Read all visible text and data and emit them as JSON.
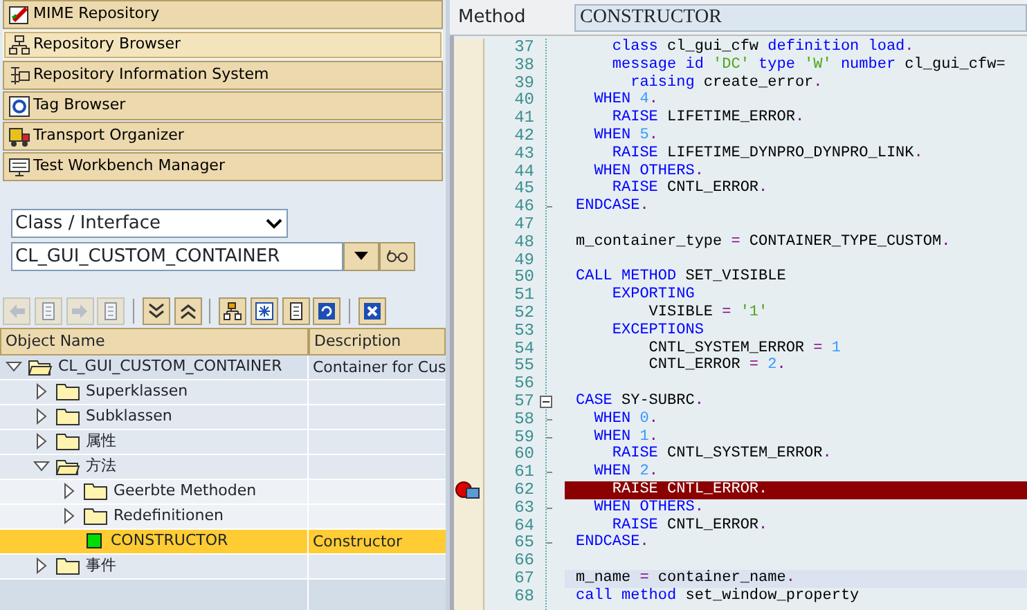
{
  "nav_buttons": [
    {
      "label": "MIME Repository",
      "selected": false
    },
    {
      "label": "Repository Browser",
      "selected": true
    },
    {
      "label": "Repository Information System",
      "selected": false
    },
    {
      "label": "Tag Browser",
      "selected": false
    },
    {
      "label": "Transport Organizer",
      "selected": false
    },
    {
      "label": "Test Workbench Manager",
      "selected": false
    }
  ],
  "object_type": {
    "value": "Class / Interface"
  },
  "object_name": {
    "value": "CL_GUI_CUSTOM_CONTAINER"
  },
  "toolbar": [
    {
      "kind": "back",
      "disabled": true
    },
    {
      "kind": "doc",
      "disabled": true
    },
    {
      "kind": "forward",
      "disabled": true
    },
    {
      "kind": "doc",
      "disabled": true
    },
    {
      "kind": "sep"
    },
    {
      "kind": "expand",
      "disabled": false
    },
    {
      "kind": "collapse",
      "disabled": false
    },
    {
      "kind": "sep"
    },
    {
      "kind": "hierarchy",
      "disabled": false
    },
    {
      "kind": "new",
      "disabled": false
    },
    {
      "kind": "doc",
      "disabled": false
    },
    {
      "kind": "refresh",
      "disabled": false
    },
    {
      "kind": "sep"
    },
    {
      "kind": "close",
      "disabled": false
    }
  ],
  "tree": {
    "columns": [
      "Object Name",
      "Description"
    ],
    "rows": [
      {
        "name": "CL_GUI_CUSTOM_CONTAINER",
        "description": "Container for Cus",
        "expanded": true,
        "selected": false,
        "children": [
          {
            "name": "Superklassen",
            "expanded": false,
            "selected": false
          },
          {
            "name": "Subklassen",
            "expanded": false,
            "selected": false
          },
          {
            "name": "属性",
            "expanded": false,
            "selected": false
          },
          {
            "name": "方法",
            "expanded": true,
            "selected": false,
            "children": [
              {
                "name": "Geerbte Methoden",
                "expanded": false,
                "selected": false
              },
              {
                "name": "Redefinitionen",
                "expanded": false,
                "selected": false
              },
              {
                "name": "CONSTRUCTOR",
                "description": "Constructor",
                "selected": true
              }
            ]
          },
          {
            "name": "事件",
            "expanded": false,
            "selected": false
          }
        ]
      }
    ]
  },
  "editor": {
    "label": "Method",
    "value": "CONSTRUCTOR",
    "lines": [
      {
        "number": "37",
        "tokens": [
          {
            "kind": "kw",
            "text": "    class"
          },
          {
            "kind": "txt",
            "text": " cl_gui_cfw "
          },
          {
            "kind": "kw",
            "text": "definition load"
          },
          {
            "kind": "op",
            "text": "."
          }
        ]
      },
      {
        "number": "38",
        "tokens": [
          {
            "kind": "kw",
            "text": "    message id "
          },
          {
            "kind": "str",
            "text": "'DC'"
          },
          {
            "kind": "kw",
            "text": " type "
          },
          {
            "kind": "str",
            "text": "'W'"
          },
          {
            "kind": "kw",
            "text": " number"
          },
          {
            "kind": "txt",
            "text": " cl_gui_cfw="
          }
        ]
      },
      {
        "number": "39",
        "tokens": [
          {
            "kind": "kw",
            "text": "      raising"
          },
          {
            "kind": "txt",
            "text": " create_error"
          },
          {
            "kind": "op",
            "text": "."
          }
        ]
      },
      {
        "number": "40",
        "tokens": [
          {
            "kind": "kw",
            "text": "  WHEN"
          },
          {
            "kind": "num",
            "text": " 4"
          },
          {
            "kind": "op",
            "text": "."
          }
        ]
      },
      {
        "number": "41",
        "tokens": [
          {
            "kind": "kw",
            "text": "    RAISE"
          },
          {
            "kind": "txt",
            "text": " LIFETIME_ERROR"
          },
          {
            "kind": "op",
            "text": "."
          }
        ]
      },
      {
        "number": "42",
        "tokens": [
          {
            "kind": "kw",
            "text": "  WHEN"
          },
          {
            "kind": "num",
            "text": " 5"
          },
          {
            "kind": "op",
            "text": "."
          }
        ]
      },
      {
        "number": "43",
        "tokens": [
          {
            "kind": "kw",
            "text": "    RAISE"
          },
          {
            "kind": "txt",
            "text": " LIFETIME_DYNPRO_DYNPRO_LINK"
          },
          {
            "kind": "op",
            "text": "."
          }
        ]
      },
      {
        "number": "44",
        "tokens": [
          {
            "kind": "kw",
            "text": "  WHEN OTHERS"
          },
          {
            "kind": "op",
            "text": "."
          }
        ]
      },
      {
        "number": "45",
        "tokens": [
          {
            "kind": "kw",
            "text": "    RAISE"
          },
          {
            "kind": "txt",
            "text": " CNTL_ERROR"
          },
          {
            "kind": "op",
            "text": "."
          }
        ]
      },
      {
        "number": "46",
        "kind": "fold_end",
        "tokens": [
          {
            "kind": "kw",
            "text": "ENDCASE"
          },
          {
            "kind": "op",
            "text": "."
          }
        ]
      },
      {
        "number": "47"
      },
      {
        "number": "48",
        "tokens": [
          {
            "kind": "txt",
            "text": "m_container_type "
          },
          {
            "kind": "op",
            "text": "="
          },
          {
            "kind": "txt",
            "text": " CONTAINER_TYPE_CUSTOM"
          },
          {
            "kind": "op",
            "text": "."
          }
        ]
      },
      {
        "number": "49"
      },
      {
        "number": "50",
        "tokens": [
          {
            "kind": "kw",
            "text": "CALL METHOD"
          },
          {
            "kind": "txt",
            "text": " SET_VISIBLE"
          }
        ]
      },
      {
        "number": "51",
        "tokens": [
          {
            "kind": "kw",
            "text": "    EXPORTING"
          }
        ]
      },
      {
        "number": "52",
        "tokens": [
          {
            "kind": "txt",
            "text": "        VISIBLE "
          },
          {
            "kind": "op",
            "text": "="
          },
          {
            "kind": "str",
            "text": " '1'"
          }
        ]
      },
      {
        "number": "53",
        "tokens": [
          {
            "kind": "kw",
            "text": "    EXCEPTIONS"
          }
        ]
      },
      {
        "number": "54",
        "tokens": [
          {
            "kind": "txt",
            "text": "        CNTL_SYSTEM_ERROR "
          },
          {
            "kind": "op",
            "text": "="
          },
          {
            "kind": "num",
            "text": " 1"
          }
        ]
      },
      {
        "number": "55",
        "tokens": [
          {
            "kind": "txt",
            "text": "        CNTL_ERROR "
          },
          {
            "kind": "op",
            "text": "="
          },
          {
            "kind": "num",
            "text": " 2"
          },
          {
            "kind": "op",
            "text": "."
          }
        ]
      },
      {
        "number": "56"
      },
      {
        "number": "57",
        "kind": "fold_start",
        "tokens": [
          {
            "kind": "kw",
            "text": "CASE"
          },
          {
            "kind": "txt",
            "text": " SY-SUBRC"
          },
          {
            "kind": "op",
            "text": "."
          }
        ]
      },
      {
        "number": "58",
        "kind": "fold_branch",
        "tokens": [
          {
            "kind": "kw",
            "text": "  WHEN"
          },
          {
            "kind": "num",
            "text": " 0"
          },
          {
            "kind": "op",
            "text": "."
          }
        ]
      },
      {
        "number": "59",
        "kind": "fold_branch",
        "tokens": [
          {
            "kind": "kw",
            "text": "  WHEN"
          },
          {
            "kind": "num",
            "text": " 1"
          },
          {
            "kind": "op",
            "text": "."
          }
        ]
      },
      {
        "number": "60",
        "tokens": [
          {
            "kind": "kw",
            "text": "    RAISE"
          },
          {
            "kind": "txt",
            "text": " CNTL_SYSTEM_ERROR"
          },
          {
            "kind": "op",
            "text": "."
          }
        ]
      },
      {
        "number": "61",
        "kind": "fold_branch",
        "tokens": [
          {
            "kind": "kw",
            "text": "  WHEN"
          },
          {
            "kind": "num",
            "text": " 2"
          },
          {
            "kind": "op",
            "text": "."
          }
        ]
      },
      {
        "number": "62",
        "breakpoint": true,
        "tokens": [
          {
            "kind": "kw",
            "text": "    RAISE"
          },
          {
            "kind": "txt",
            "text": " CNTL_ERROR"
          },
          {
            "kind": "op",
            "text": "."
          }
        ]
      },
      {
        "number": "63",
        "kind": "fold_branch",
        "tokens": [
          {
            "kind": "kw",
            "text": "  WHEN OTHERS"
          },
          {
            "kind": "op",
            "text": "."
          }
        ]
      },
      {
        "number": "64",
        "tokens": [
          {
            "kind": "kw",
            "text": "    RAISE"
          },
          {
            "kind": "txt",
            "text": " CNTL_ERROR"
          },
          {
            "kind": "op",
            "text": "."
          }
        ]
      },
      {
        "number": "65",
        "kind": "fold_end",
        "tokens": [
          {
            "kind": "kw",
            "text": "ENDCASE"
          },
          {
            "kind": "op",
            "text": "."
          }
        ]
      },
      {
        "number": "66"
      },
      {
        "number": "67",
        "current": true,
        "tokens": [
          {
            "kind": "txt",
            "text": "m_name "
          },
          {
            "kind": "op",
            "text": "="
          },
          {
            "kind": "txt",
            "text": " container_name"
          },
          {
            "kind": "op",
            "text": "."
          }
        ]
      },
      {
        "number": "68",
        "tokens": [
          {
            "kind": "kw",
            "text": "call method"
          },
          {
            "kind": "txt",
            "text": " set_window_property"
          }
        ]
      }
    ]
  }
}
